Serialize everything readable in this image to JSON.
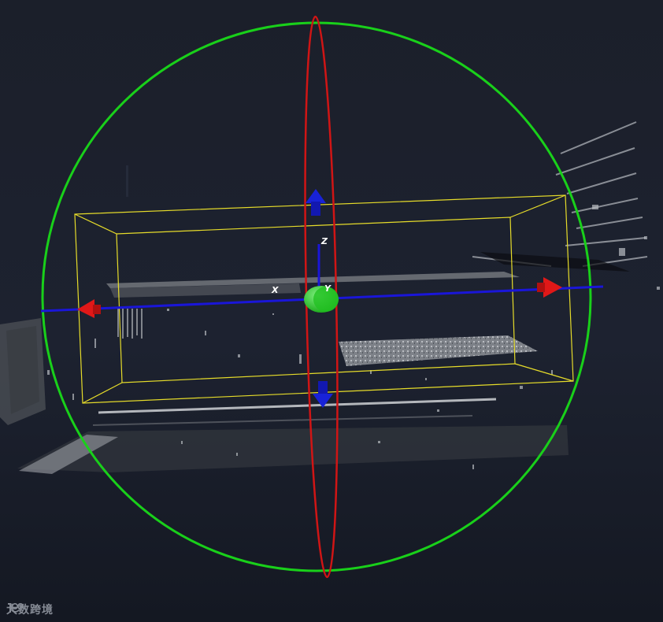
{
  "viewport": {
    "background": "#1c212c",
    "colors": {
      "sphere_ring": "#19d01a",
      "rotation_ring": "#d01515",
      "x_axis": "#1a16d8",
      "bounding_box": "#e6dc2a",
      "arrow_x": "#e01818",
      "arrow_z": "#1822d8",
      "center_handle": "#2bd12b"
    }
  },
  "gizmo": {
    "x_label": "X",
    "y_label": "Y",
    "z_label": "Z",
    "icons": {
      "x_neg_arrow": "arrow-left-icon",
      "x_pos_arrow": "arrow-right-icon",
      "z_pos_arrow": "arrow-up-icon",
      "z_neg_arrow": "arrow-down-icon",
      "center": "sphere-handle-icon"
    }
  },
  "watermark": {
    "text": "大数跨境"
  }
}
